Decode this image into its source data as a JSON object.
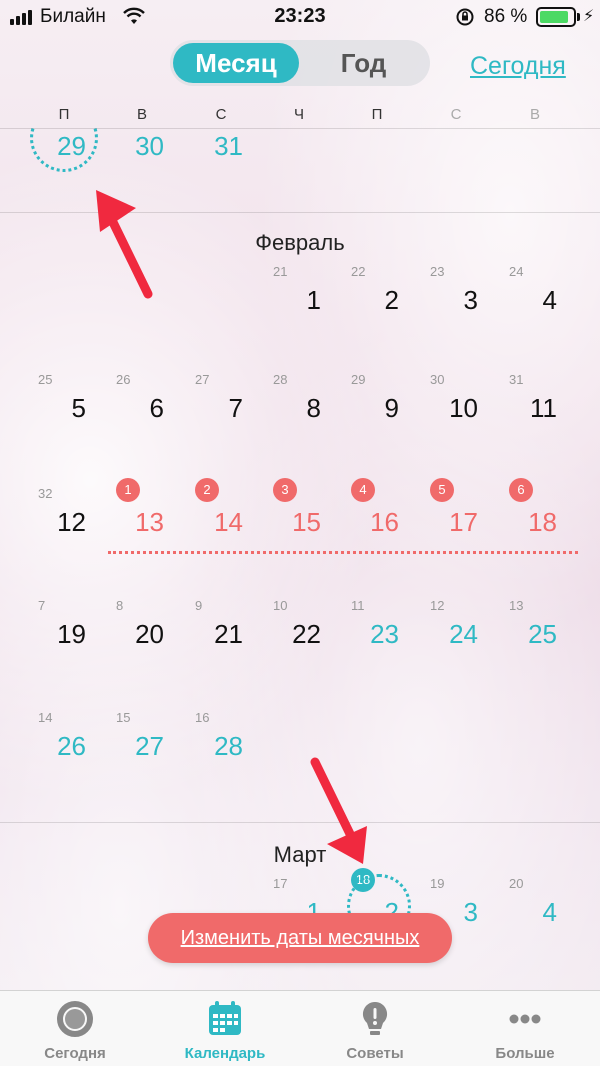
{
  "status_bar": {
    "carrier": "Билайн",
    "time": "23:23",
    "battery_percent": "86 %",
    "battery_level": 0.86
  },
  "segmented": {
    "month_label": "Месяц",
    "year_label": "Год",
    "selected": "month"
  },
  "today_link": "Сегодня",
  "weekdays": [
    "П",
    "В",
    "С",
    "Ч",
    "П",
    "С",
    "В"
  ],
  "january_tail": [
    {
      "day": "29",
      "today_marker": true
    },
    {
      "day": "30"
    },
    {
      "day": "31"
    }
  ],
  "february": {
    "title": "Февраль",
    "weeks": [
      [
        null,
        null,
        null,
        {
          "day": "1",
          "sub": "21"
        },
        {
          "day": "2",
          "sub": "22"
        },
        {
          "day": "3",
          "sub": "23"
        },
        {
          "day": "4",
          "sub": "24"
        }
      ],
      [
        {
          "day": "5",
          "sub": "25"
        },
        {
          "day": "6",
          "sub": "26"
        },
        {
          "day": "7",
          "sub": "27"
        },
        {
          "day": "8",
          "sub": "28"
        },
        {
          "day": "9",
          "sub": "29"
        },
        {
          "day": "10",
          "sub": "30"
        },
        {
          "day": "11",
          "sub": "31"
        }
      ],
      [
        {
          "day": "12",
          "sub": "32"
        },
        {
          "day": "13",
          "badge": "1"
        },
        {
          "day": "14",
          "badge": "2"
        },
        {
          "day": "15",
          "badge": "3"
        },
        {
          "day": "16",
          "badge": "4"
        },
        {
          "day": "17",
          "badge": "5"
        },
        {
          "day": "18",
          "badge": "6"
        }
      ],
      [
        {
          "day": "19",
          "sub": "7"
        },
        {
          "day": "20",
          "sub": "8"
        },
        {
          "day": "21",
          "sub": "9"
        },
        {
          "day": "22",
          "sub": "10"
        },
        {
          "day": "23",
          "sub": "11",
          "teal": true
        },
        {
          "day": "24",
          "sub": "12",
          "teal": true
        },
        {
          "day": "25",
          "sub": "13",
          "teal": true
        }
      ],
      [
        {
          "day": "26",
          "sub": "14",
          "teal": true
        },
        {
          "day": "27",
          "sub": "15",
          "teal": true
        },
        {
          "day": "28",
          "sub": "16",
          "teal": true
        },
        null,
        null,
        null,
        null
      ]
    ]
  },
  "march": {
    "title": "Март",
    "weeks": [
      [
        null,
        null,
        null,
        {
          "day": "1",
          "sub": "17",
          "teal": true
        },
        {
          "day": "2",
          "badge": "18",
          "teal": true
        },
        {
          "day": "3",
          "sub": "19",
          "teal": true
        },
        {
          "day": "4",
          "sub": "20",
          "teal": true
        }
      ]
    ]
  },
  "edit_period_button": "Изменить даты месячных",
  "tab_bar": {
    "active": "calendar",
    "tabs": [
      {
        "id": "today",
        "label": "Сегодня",
        "icon": "ring-icon"
      },
      {
        "id": "calendar",
        "label": "Календарь",
        "icon": "calendar-icon"
      },
      {
        "id": "tips",
        "label": "Советы",
        "icon": "lightbulb-icon"
      },
      {
        "id": "more",
        "label": "Больше",
        "icon": "more-dots-icon"
      }
    ]
  },
  "colors": {
    "accent": "#2fb9c4",
    "period": "#f06a6a",
    "arrow": "#f0293f"
  }
}
